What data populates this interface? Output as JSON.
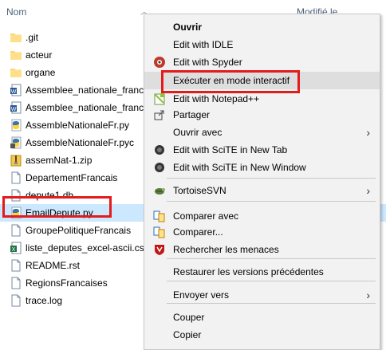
{
  "header": {
    "name_col": "Nom",
    "modified_col": "Modifié le"
  },
  "files": [
    {
      "name": ".git",
      "icon": "folder-icon"
    },
    {
      "name": "acteur",
      "icon": "folder-icon"
    },
    {
      "name": "organe",
      "icon": "folder-icon"
    },
    {
      "name": "Assemblee_nationale_francai",
      "icon": "word-doc-icon"
    },
    {
      "name": "Assemblee_nationale_francai",
      "icon": "word-doc-icon"
    },
    {
      "name": "AssembleNationaleFr.py",
      "icon": "python-file-icon"
    },
    {
      "name": "AssembleNationaleFr.pyc",
      "icon": "python-compiled-icon"
    },
    {
      "name": "assemNat-1.zip",
      "icon": "zip-icon"
    },
    {
      "name": "DepartementFrancais",
      "icon": "file-icon"
    },
    {
      "name": "depute1.db",
      "icon": "file-icon"
    },
    {
      "name": "EmailDepute.py",
      "icon": "python-file-icon"
    },
    {
      "name": "GroupePolitiqueFrancais",
      "icon": "file-icon"
    },
    {
      "name": "liste_deputes_excel-ascii.csv",
      "icon": "excel-csv-icon"
    },
    {
      "name": "README.rst",
      "icon": "file-icon"
    },
    {
      "name": "RegionsFrancaises",
      "icon": "file-icon"
    },
    {
      "name": "trace.log",
      "icon": "file-icon"
    }
  ],
  "menu": {
    "items": [
      {
        "label": "Ouvrir",
        "bold": true
      },
      {
        "label": "Edit with IDLE"
      },
      {
        "label": "Edit with Spyder",
        "icon": "spyder-icon"
      },
      {
        "label": "Exécuter en mode interactif"
      },
      {
        "label": "Edit with Notepad++",
        "icon": "notepadpp-icon"
      },
      {
        "label": "Partager",
        "icon": "share-icon"
      },
      {
        "label": "Ouvrir avec",
        "submenu": true
      },
      {
        "label": "Edit with SciTE in New Tab",
        "icon": "scite-icon"
      },
      {
        "label": "Edit with SciTE in New Window",
        "icon": "scite-icon"
      },
      {
        "label": "TortoiseSVN",
        "icon": "tortoisesvn-icon",
        "submenu": true
      },
      {
        "label": "Comparer avec",
        "icon": "compare-icon"
      },
      {
        "label": "Comparer...",
        "icon": "compare-icon"
      },
      {
        "label": "Rechercher les menaces",
        "icon": "mcafee-icon"
      },
      {
        "label": "Restaurer les versions précédentes"
      },
      {
        "label": "Envoyer vers",
        "submenu": true
      },
      {
        "label": "Couper"
      },
      {
        "label": "Copier"
      }
    ]
  },
  "colors": {
    "highlight": "#e21b1b",
    "selection": "#cce8ff",
    "menu_bg": "#f2f2f2"
  }
}
